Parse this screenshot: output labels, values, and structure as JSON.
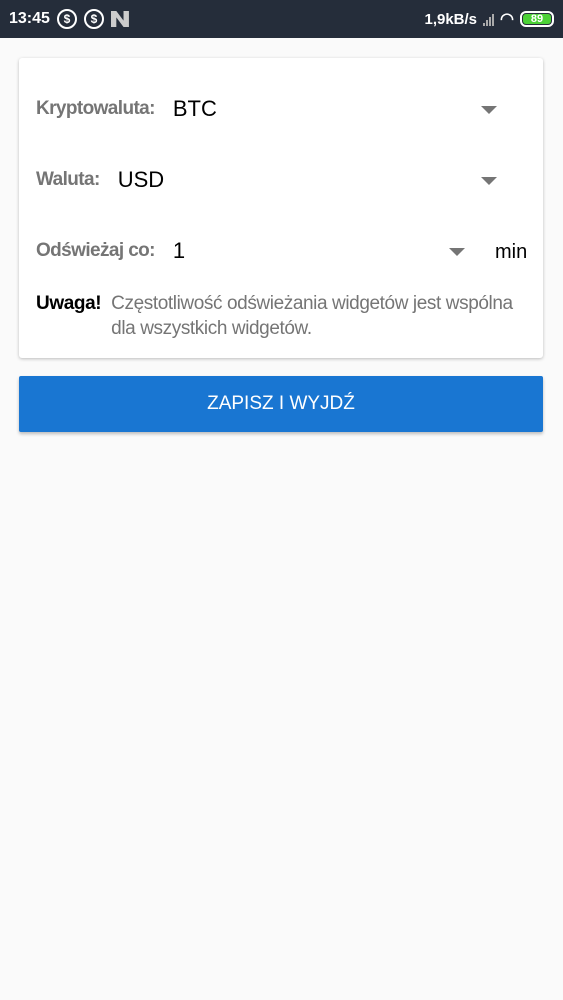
{
  "status_bar": {
    "time": "13:45",
    "net_speed": "1,9kB/s",
    "battery": "89",
    "notification_icons": [
      "dollar-icon",
      "dollar-icon",
      "n-icon"
    ]
  },
  "form": {
    "crypto": {
      "label": "Kryptowaluta:",
      "value": "BTC"
    },
    "currency": {
      "label": "Waluta:",
      "value": "USD"
    },
    "refresh": {
      "label": "Odświeżaj co:",
      "value": "1",
      "unit": "min"
    },
    "note": {
      "title": "Uwaga!",
      "text": "Częstotliwość odświeżania widgetów jest wspólna dla wszystkich widgetów."
    }
  },
  "save_button": "ZAPISZ I WYJDŹ",
  "colors": {
    "accent": "#1976d2",
    "status_bar": "#252d3a"
  }
}
